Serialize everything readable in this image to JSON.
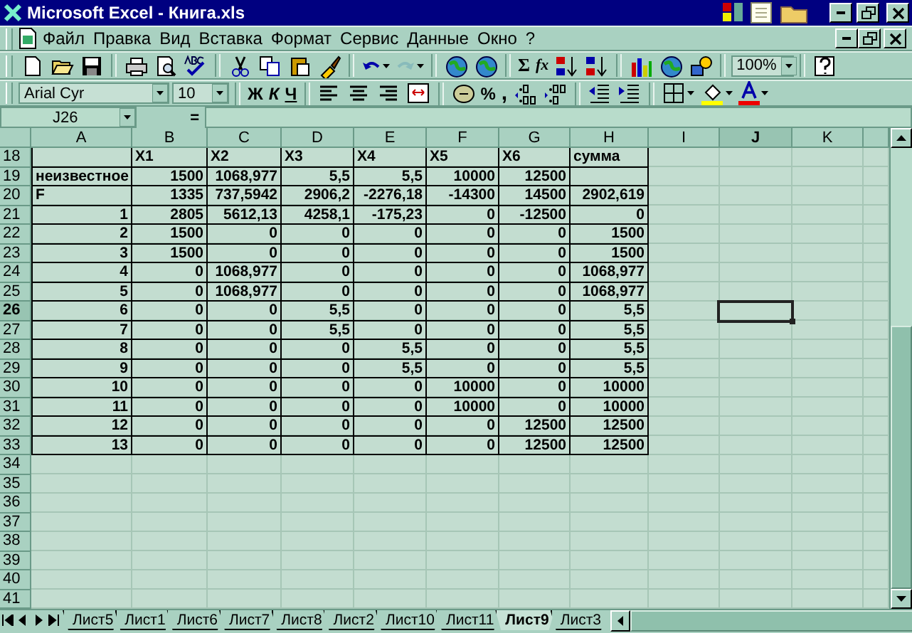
{
  "window": {
    "title": "Microsoft Excel - Книга.xls"
  },
  "menu": [
    "Файл",
    "Правка",
    "Вид",
    "Вставка",
    "Формат",
    "Сервис",
    "Данные",
    "Окно",
    "?"
  ],
  "standard_toolbar": {
    "sum": "Σ",
    "function": "fx",
    "zoom": "100%"
  },
  "formatting_toolbar": {
    "font": "Arial Cyr",
    "size": "10",
    "bold": "Ж",
    "italic": "К",
    "underline": "Ч",
    "percent": "%",
    "comma": ","
  },
  "formula_bar": {
    "name_box": "J26",
    "equals": "="
  },
  "columns": [
    {
      "label": "A",
      "selected": false
    },
    {
      "label": "B",
      "selected": false
    },
    {
      "label": "C",
      "selected": false
    },
    {
      "label": "D",
      "selected": false
    },
    {
      "label": "E",
      "selected": false
    },
    {
      "label": "F",
      "selected": false
    },
    {
      "label": "G",
      "selected": false
    },
    {
      "label": "H",
      "selected": false
    },
    {
      "label": "I",
      "selected": false
    },
    {
      "label": "J",
      "selected": true
    },
    {
      "label": "K",
      "selected": false
    }
  ],
  "rows": [
    {
      "number": "18",
      "selected": false,
      "cells": {
        "B": "X1",
        "C": "X2",
        "D": "X3",
        "E": "X4",
        "F": "X5",
        "G": "X6",
        "H": "сумма"
      }
    },
    {
      "number": "19",
      "selected": false,
      "cells": {
        "A": "неизвестное",
        "B": "1500",
        "C": "1068,977",
        "D": "5,5",
        "E": "5,5",
        "F": "10000",
        "G": "12500"
      }
    },
    {
      "number": "20",
      "selected": false,
      "cells": {
        "A": "F",
        "B": "1335",
        "C": "737,5942",
        "D": "2906,2",
        "E": "-2276,18",
        "F": "-14300",
        "G": "14500",
        "H": "2902,619"
      }
    },
    {
      "number": "21",
      "selected": false,
      "cells": {
        "A": "1",
        "B": "2805",
        "C": "5612,13",
        "D": "4258,1",
        "E": "-175,23",
        "F": "0",
        "G": "-12500",
        "H": "0"
      }
    },
    {
      "number": "22",
      "selected": false,
      "cells": {
        "A": "2",
        "B": "1500",
        "C": "0",
        "D": "0",
        "E": "0",
        "F": "0",
        "G": "0",
        "H": "1500"
      }
    },
    {
      "number": "23",
      "selected": false,
      "cells": {
        "A": "3",
        "B": "1500",
        "C": "0",
        "D": "0",
        "E": "0",
        "F": "0",
        "G": "0",
        "H": "1500"
      }
    },
    {
      "number": "24",
      "selected": false,
      "cells": {
        "A": "4",
        "B": "0",
        "C": "1068,977",
        "D": "0",
        "E": "0",
        "F": "0",
        "G": "0",
        "H": "1068,977"
      }
    },
    {
      "number": "25",
      "selected": false,
      "cells": {
        "A": "5",
        "B": "0",
        "C": "1068,977",
        "D": "0",
        "E": "0",
        "F": "0",
        "G": "0",
        "H": "1068,977"
      }
    },
    {
      "number": "26",
      "selected": true,
      "cells": {
        "A": "6",
        "B": "0",
        "C": "0",
        "D": "5,5",
        "E": "0",
        "F": "0",
        "G": "0",
        "H": "5,5"
      }
    },
    {
      "number": "27",
      "selected": false,
      "cells": {
        "A": "7",
        "B": "0",
        "C": "0",
        "D": "5,5",
        "E": "0",
        "F": "0",
        "G": "0",
        "H": "5,5"
      }
    },
    {
      "number": "28",
      "selected": false,
      "cells": {
        "A": "8",
        "B": "0",
        "C": "0",
        "D": "0",
        "E": "5,5",
        "F": "0",
        "G": "0",
        "H": "5,5"
      }
    },
    {
      "number": "29",
      "selected": false,
      "cells": {
        "A": "9",
        "B": "0",
        "C": "0",
        "D": "0",
        "E": "5,5",
        "F": "0",
        "G": "0",
        "H": "5,5"
      }
    },
    {
      "number": "30",
      "selected": false,
      "cells": {
        "A": "10",
        "B": "0",
        "C": "0",
        "D": "0",
        "E": "0",
        "F": "10000",
        "G": "0",
        "H": "10000"
      }
    },
    {
      "number": "31",
      "selected": false,
      "cells": {
        "A": "11",
        "B": "0",
        "C": "0",
        "D": "0",
        "E": "0",
        "F": "10000",
        "G": "0",
        "H": "10000"
      }
    },
    {
      "number": "32",
      "selected": false,
      "cells": {
        "A": "12",
        "B": "0",
        "C": "0",
        "D": "0",
        "E": "0",
        "F": "0",
        "G": "12500",
        "H": "12500"
      }
    },
    {
      "number": "33",
      "selected": false,
      "cells": {
        "A": "13",
        "B": "0",
        "C": "0",
        "D": "0",
        "E": "0",
        "F": "0",
        "G": "12500",
        "H": "12500"
      }
    },
    {
      "number": "34",
      "selected": false
    },
    {
      "number": "35",
      "selected": false
    },
    {
      "number": "36",
      "selected": false
    },
    {
      "number": "37",
      "selected": false
    },
    {
      "number": "38",
      "selected": false
    },
    {
      "number": "39",
      "selected": false
    },
    {
      "number": "40",
      "selected": false
    },
    {
      "number": "41",
      "selected": false
    }
  ],
  "sheet_tabs": [
    {
      "label": "Лист5",
      "selected": false
    },
    {
      "label": "Лист1",
      "selected": false
    },
    {
      "label": "Лист6",
      "selected": false
    },
    {
      "label": "Лист7",
      "selected": false
    },
    {
      "label": "Лист8",
      "selected": false
    },
    {
      "label": "Лист2",
      "selected": false
    },
    {
      "label": "Лист10",
      "selected": false
    },
    {
      "label": "Лист11",
      "selected": false
    },
    {
      "label": "Лист9",
      "selected": true
    },
    {
      "label": "Лист3",
      "selected": false
    }
  ]
}
